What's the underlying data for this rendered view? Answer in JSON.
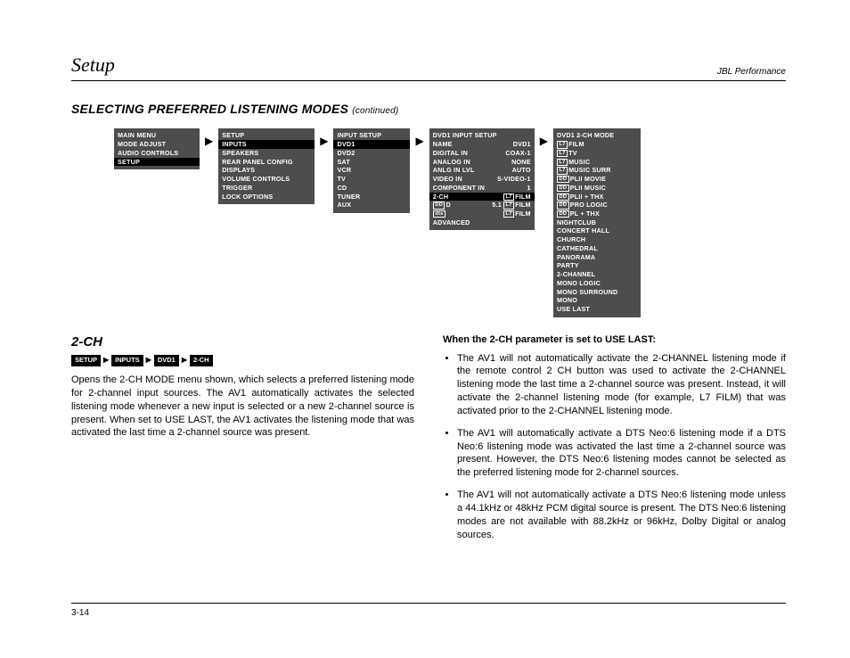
{
  "header": {
    "left": "Setup",
    "right": "JBL Performance"
  },
  "section": {
    "title": "SELECTING PREFERRED LISTENING MODES",
    "continued": "(continued)"
  },
  "menus": {
    "main": {
      "title": "MAIN MENU",
      "items": [
        "MODE ADJUST",
        "AUDIO CONTROLS",
        "SETUP"
      ],
      "hl": 2
    },
    "setup": {
      "title": "SETUP",
      "items": [
        "INPUTS",
        "SPEAKERS",
        "REAR PANEL CONFIG",
        "DISPLAYS",
        "VOLUME CONTROLS",
        "TRIGGER",
        "LOCK OPTIONS"
      ],
      "hl": 0
    },
    "input": {
      "title": "INPUT SETUP",
      "items": [
        "DVD1",
        "DVD2",
        "SAT",
        "VCR",
        "TV",
        "CD",
        "TUNER",
        "AUX"
      ],
      "hl": 0
    },
    "dvd1": {
      "title": "DVD1 INPUT SETUP",
      "rows": [
        {
          "k": "NAME",
          "v": "DVD1"
        },
        {
          "k": "DIGITAL IN",
          "v": "COAX-1"
        },
        {
          "k": "ANALOG IN",
          "v": "NONE"
        },
        {
          "k": "ANLG IN LVL",
          "v": "AUTO"
        },
        {
          "k": "VIDEO IN",
          "v": "S-VIDEO-1"
        },
        {
          "k": "COMPONENT IN",
          "v": "1"
        }
      ],
      "twoch": {
        "k": "2-CH",
        "v": "FILM"
      },
      "dd": {
        "k": "D",
        "v": "5.1",
        "v2": "FILM"
      },
      "dts": {
        "k": "dts",
        "v2": "FILM"
      },
      "adv": "ADVANCED"
    },
    "mode": {
      "title": "DVD1 2-CH MODE",
      "items": [
        "FILM",
        "TV",
        "MUSIC",
        "MUSIC SURR",
        "PLII MOVIE",
        "PLII MUSIC",
        "PLII + THX",
        "PRO LOGIC",
        "PL + THX",
        "NIGHTCLUB",
        "CONCERT HALL",
        "CHURCH",
        "CATHEDRAL",
        "PANORAMA",
        "PARTY",
        "2-CHANNEL",
        "MONO LOGIC",
        "MONO SURROUND",
        "MONO",
        "USE LAST"
      ],
      "l7idx": [
        0,
        1,
        2,
        3
      ],
      "ddidx": [
        4,
        5,
        6,
        7,
        8
      ]
    }
  },
  "left": {
    "heading": "2-CH",
    "crumbs": [
      "SETUP",
      "INPUTS",
      "DVD1",
      "2-CH"
    ],
    "para": "Opens the 2-CH MODE menu shown, which selects a preferred listening mode for 2-channel input sources. The AV1 automatically activates the selected listening mode whenever a new input is selected or a new 2-channel source is present. When set to USE LAST, the AV1 activates the listening mode that was activated the last time a 2-channel source was present."
  },
  "right": {
    "heading": "When the 2-CH parameter is set to USE LAST:",
    "bullets": [
      "The AV1 will not automatically activate the 2-CHANNEL listening mode if the remote control 2 CH button was used to activate the 2-CHANNEL listening mode the last time a 2-channel source was present. Instead, it will activate the 2-channel listening mode (for example, L7 FILM) that was activated prior to the 2-CHANNEL listening mode.",
      "The AV1 will automatically activate a DTS Neo:6 listening mode if a DTS Neo:6 listening mode was activated the last time a 2-channel source was present. However, the DTS Neo:6 listening modes cannot be selected as the preferred listening mode for 2-channel sources.",
      "The AV1 will not automatically activate a DTS Neo:6 listening mode unless a 44.1kHz or 48kHz PCM digital source is present. The DTS Neo:6 listening modes are not available with 88.2kHz or 96kHz, Dolby Digital or analog sources."
    ]
  },
  "footer": {
    "page": "3-14"
  }
}
